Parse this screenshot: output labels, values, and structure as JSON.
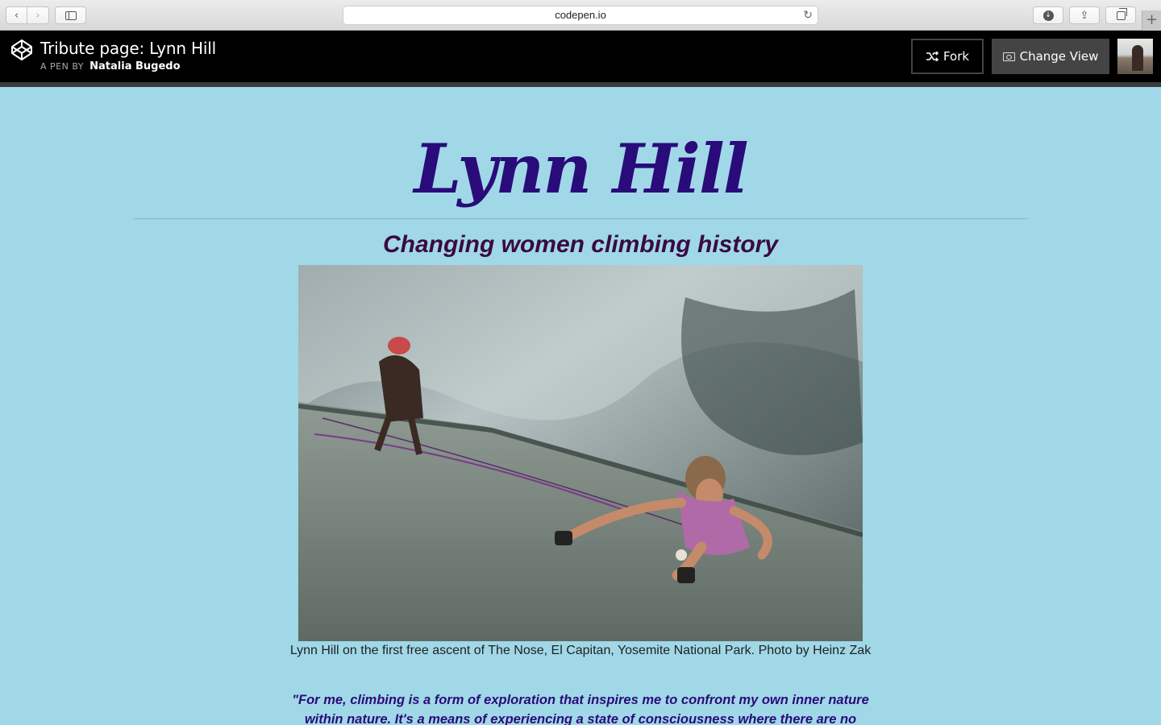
{
  "browser": {
    "url": "codepen.io",
    "back_icon": "chevron-left-icon",
    "forward_icon": "chevron-right-icon",
    "newtab_label": "+"
  },
  "codepen": {
    "pen_title": "Tribute page: Lynn Hill",
    "by_label": "A PEN BY",
    "author": "Natalia Bugedo",
    "fork_label": "Fork",
    "change_view_label": "Change View"
  },
  "page": {
    "title": "Lynn Hill",
    "subtitle_pre": "Changing ",
    "subtitle_bold": "women climbing",
    "subtitle_post": " history",
    "caption": "Lynn Hill on the first free ascent of The Nose, El Capitan, Yosemite National Park. Photo by Heinz Zak",
    "quote": "\"For me, climbing is a form of exploration that inspires me to confront my own inner nature within nature. It's a means of experiencing a state of consciousness where there are no"
  },
  "colors": {
    "page_background": "#a0d8e8",
    "title": "#2a0b7a",
    "subtitle": "#3a0a42",
    "header_background": "#000000"
  }
}
